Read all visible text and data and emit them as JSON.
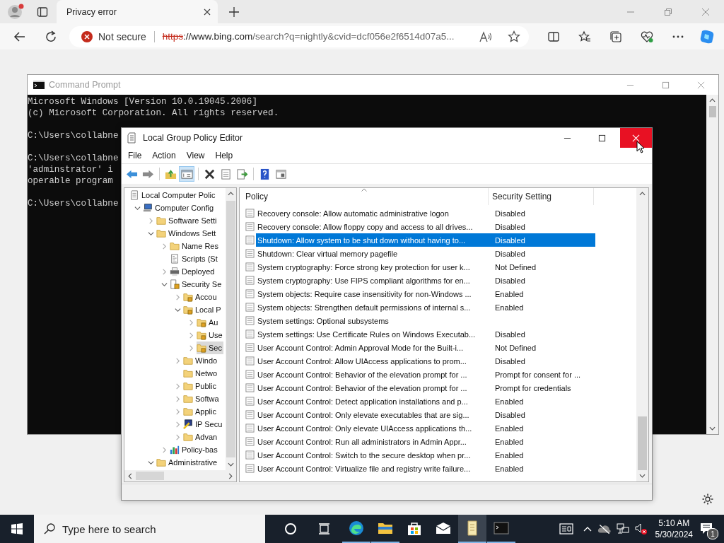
{
  "browser": {
    "tab_title": "Privacy error",
    "security_label": "Not secure",
    "url": {
      "scheme": "https",
      "host": "://www.bing.com",
      "path": "/search?q=nightly&cvid=dcf056e2f6514d07a5..."
    }
  },
  "cmd": {
    "title": "Command Prompt",
    "blocks": [
      [
        "Microsoft Windows [Version 10.0.19045.2006]",
        "(c) Microsoft Corporation. All rights reserved."
      ],
      [
        "C:\\Users\\collabne"
      ],
      [
        "C:\\Users\\collabne",
        "'adminstrator' i",
        "operable program"
      ],
      [
        "C:\\Users\\collabne"
      ]
    ]
  },
  "gpedit": {
    "title": "Local Group Policy Editor",
    "menu": [
      "File",
      "Action",
      "View",
      "Help"
    ],
    "toolbar": [
      [
        {
          "kind": "back",
          "pressed": false
        },
        {
          "kind": "forward",
          "pressed": false
        }
      ],
      [
        {
          "kind": "up",
          "pressed": false
        },
        {
          "kind": "tree",
          "pressed": true
        }
      ],
      [
        {
          "kind": "delete",
          "pressed": false
        },
        {
          "kind": "properties",
          "pressed": false
        },
        {
          "kind": "export",
          "pressed": false
        }
      ],
      [
        {
          "kind": "help",
          "pressed": false
        },
        {
          "kind": "view",
          "pressed": false
        }
      ]
    ],
    "tree": [
      {
        "label": "Local Computer Polic",
        "kind": "document",
        "selected": false,
        "children": [
          {
            "label": "Computer Config",
            "kind": "computer",
            "selected": false,
            "expanded": true,
            "children": [
              {
                "label": "Software Setti",
                "kind": "folder",
                "selected": false,
                "expanded": false
              },
              {
                "label": "Windows Sett",
                "kind": "folder",
                "selected": false,
                "expanded": true,
                "children": [
                  {
                    "label": "Name Res",
                    "kind": "folder",
                    "selected": false,
                    "expanded": false
                  },
                  {
                    "label": "Scripts (St",
                    "kind": "script",
                    "selected": false
                  },
                  {
                    "label": "Deployed",
                    "kind": "printer",
                    "selected": false,
                    "expanded": false
                  },
                  {
                    "label": "Security Se",
                    "kind": "security",
                    "selected": false,
                    "expanded": true,
                    "children": [
                      {
                        "label": "Accou",
                        "kind": "locked-folder",
                        "selected": false,
                        "expanded": false
                      },
                      {
                        "label": "Local P",
                        "kind": "locked-folder",
                        "selected": false,
                        "expanded": true,
                        "children": [
                          {
                            "label": "Au",
                            "kind": "locked-folder",
                            "selected": false,
                            "expanded": false
                          },
                          {
                            "label": "Use",
                            "kind": "locked-folder",
                            "selected": false,
                            "expanded": false
                          },
                          {
                            "label": "Sec",
                            "kind": "locked-folder",
                            "selected": true,
                            "expanded": false
                          }
                        ]
                      },
                      {
                        "label": "Windo",
                        "kind": "folder",
                        "selected": false,
                        "expanded": false
                      },
                      {
                        "label": "Netwo",
                        "kind": "folder",
                        "selected": false
                      },
                      {
                        "label": "Public",
                        "kind": "folder",
                        "selected": false,
                        "expanded": false
                      },
                      {
                        "label": "Softwa",
                        "kind": "folder",
                        "selected": false,
                        "expanded": false
                      },
                      {
                        "label": "Applic",
                        "kind": "folder",
                        "selected": false,
                        "expanded": false
                      },
                      {
                        "label": "IP Secu",
                        "kind": "ip-security",
                        "selected": false,
                        "expanded": false
                      },
                      {
                        "label": "Advan",
                        "kind": "folder",
                        "selected": false,
                        "expanded": false
                      }
                    ]
                  },
                  {
                    "label": "Policy-bas",
                    "kind": "chart",
                    "selected": false,
                    "expanded": false
                  }
                ]
              },
              {
                "label": "Administrative",
                "kind": "folder",
                "selected": false,
                "expanded": true
              }
            ]
          }
        ]
      }
    ],
    "table": {
      "columns": [
        "Policy",
        "Security Setting"
      ],
      "rows": [
        {
          "policy": "Recovery console: Allow automatic administrative logon",
          "setting": "Disabled",
          "selected": false
        },
        {
          "policy": "Recovery console: Allow floppy copy and access to all drives...",
          "setting": "Disabled",
          "selected": false
        },
        {
          "policy": "Shutdown: Allow system to be shut down without having to...",
          "setting": "Disabled",
          "selected": true
        },
        {
          "policy": "Shutdown: Clear virtual memory pagefile",
          "setting": "Disabled",
          "selected": false
        },
        {
          "policy": "System cryptography: Force strong key protection for user k...",
          "setting": "Not Defined",
          "selected": false
        },
        {
          "policy": "System cryptography: Use FIPS compliant algorithms for en...",
          "setting": "Disabled",
          "selected": false
        },
        {
          "policy": "System objects: Require case insensitivity for non-Windows ...",
          "setting": "Enabled",
          "selected": false
        },
        {
          "policy": "System objects: Strengthen default permissions of internal s...",
          "setting": "Enabled",
          "selected": false
        },
        {
          "policy": "System settings: Optional subsystems",
          "selected": false
        },
        {
          "policy": "System settings: Use Certificate Rules on Windows Executab...",
          "setting": "Disabled",
          "selected": false
        },
        {
          "policy": "User Account Control: Admin Approval Mode for the Built-i...",
          "setting": "Not Defined",
          "selected": false
        },
        {
          "policy": "User Account Control: Allow UIAccess applications to prom...",
          "setting": "Disabled",
          "selected": false
        },
        {
          "policy": "User Account Control: Behavior of the elevation prompt for ...",
          "setting": "Prompt for consent for ...",
          "selected": false
        },
        {
          "policy": "User Account Control: Behavior of the elevation prompt for ...",
          "setting": "Prompt for credentials",
          "selected": false
        },
        {
          "policy": "User Account Control: Detect application installations and p...",
          "setting": "Enabled",
          "selected": false
        },
        {
          "policy": "User Account Control: Only elevate executables that are sig...",
          "setting": "Disabled",
          "selected": false
        },
        {
          "policy": "User Account Control: Only elevate UIAccess applications th...",
          "setting": "Enabled",
          "selected": false
        },
        {
          "policy": "User Account Control: Run all administrators in Admin Appr...",
          "setting": "Enabled",
          "selected": false
        },
        {
          "policy": "User Account Control: Switch to the secure desktop when pr...",
          "setting": "Enabled",
          "selected": false
        },
        {
          "policy": "User Account Control: Virtualize file and registry write failure...",
          "setting": "Enabled",
          "selected": false
        }
      ]
    }
  },
  "taskbar": {
    "search_placeholder": "Type here to search",
    "apps": [
      {
        "kind": "edge",
        "running": true,
        "selected": false
      },
      {
        "kind": "explorer",
        "running": true,
        "selected": false
      },
      {
        "kind": "store",
        "running": false,
        "selected": false
      },
      {
        "kind": "mail",
        "running": false,
        "selected": false
      },
      {
        "kind": "gpedit",
        "running": true,
        "selected": true
      },
      {
        "kind": "cmd",
        "running": true,
        "selected": false
      }
    ],
    "time": "5:10 AM",
    "date": "5/30/2024",
    "notification_count": "1"
  }
}
